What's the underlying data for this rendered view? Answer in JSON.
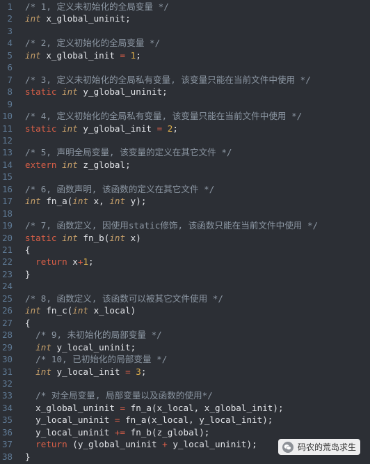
{
  "editor": {
    "line_numbers": [
      "1",
      "2",
      "3",
      "4",
      "5",
      "6",
      "7",
      "8",
      "9",
      "10",
      "11",
      "12",
      "13",
      "14",
      "15",
      "16",
      "17",
      "18",
      "19",
      "20",
      "21",
      "22",
      "23",
      "24",
      "25",
      "26",
      "27",
      "28",
      "29",
      "30",
      "31",
      "32",
      "33",
      "34",
      "35",
      "36",
      "37",
      "38"
    ],
    "lines": [
      [
        [
          "comment",
          "/* 1, 定义未初始化的全局变量 */"
        ]
      ],
      [
        [
          "type",
          "int"
        ],
        [
          "plain",
          " x_global_uninit;"
        ]
      ],
      [],
      [
        [
          "comment",
          "/* 2, 定义初始化的全局变量 */"
        ]
      ],
      [
        [
          "type",
          "int"
        ],
        [
          "plain",
          " x_global_init "
        ],
        [
          "op",
          "="
        ],
        [
          "plain",
          " "
        ],
        [
          "num",
          "1"
        ],
        [
          "plain",
          ";"
        ]
      ],
      [],
      [
        [
          "comment",
          "/* 3, 定义未初始化的全局私有变量, 该变量只能在当前文件中使用 */"
        ]
      ],
      [
        [
          "kw",
          "static"
        ],
        [
          "plain",
          " "
        ],
        [
          "type",
          "int"
        ],
        [
          "plain",
          " y_global_uninit;"
        ]
      ],
      [],
      [
        [
          "comment",
          "/* 4, 定义初始化的全局私有变量, 该变量只能在当前文件中使用 */"
        ]
      ],
      [
        [
          "kw",
          "static"
        ],
        [
          "plain",
          " "
        ],
        [
          "type",
          "int"
        ],
        [
          "plain",
          " y_global_init "
        ],
        [
          "op",
          "="
        ],
        [
          "plain",
          " "
        ],
        [
          "num",
          "2"
        ],
        [
          "plain",
          ";"
        ]
      ],
      [],
      [
        [
          "comment",
          "/* 5, 声明全局变量, 该变量的定义在其它文件 */"
        ]
      ],
      [
        [
          "kw",
          "extern"
        ],
        [
          "plain",
          " "
        ],
        [
          "type",
          "int"
        ],
        [
          "plain",
          " z_global;"
        ]
      ],
      [],
      [
        [
          "comment",
          "/* 6, 函数声明, 该函数的定义在其它文件 */"
        ]
      ],
      [
        [
          "type",
          "int"
        ],
        [
          "plain",
          " fn_a("
        ],
        [
          "type",
          "int"
        ],
        [
          "plain",
          " x, "
        ],
        [
          "type",
          "int"
        ],
        [
          "plain",
          " y);"
        ]
      ],
      [],
      [
        [
          "comment",
          "/* 7, 函数定义, 因使用static修饰, 该函数只能在当前文件中使用 */"
        ]
      ],
      [
        [
          "kw",
          "static"
        ],
        [
          "plain",
          " "
        ],
        [
          "type",
          "int"
        ],
        [
          "plain",
          " fn_b("
        ],
        [
          "type",
          "int"
        ],
        [
          "plain",
          " x)"
        ]
      ],
      [
        [
          "plain",
          "{"
        ]
      ],
      [
        [
          "plain",
          "  "
        ],
        [
          "kw",
          "return"
        ],
        [
          "plain",
          " x"
        ],
        [
          "op",
          "+"
        ],
        [
          "num",
          "1"
        ],
        [
          "plain",
          ";"
        ]
      ],
      [
        [
          "plain",
          "}"
        ]
      ],
      [],
      [
        [
          "comment",
          "/* 8, 函数定义, 该函数可以被其它文件使用 */"
        ]
      ],
      [
        [
          "type",
          "int"
        ],
        [
          "plain",
          " fn_c("
        ],
        [
          "type",
          "int"
        ],
        [
          "plain",
          " x_local)"
        ]
      ],
      [
        [
          "plain",
          "{"
        ]
      ],
      [
        [
          "plain",
          "  "
        ],
        [
          "comment",
          "/* 9, 未初始化的局部变量 */"
        ]
      ],
      [
        [
          "plain",
          "  "
        ],
        [
          "type",
          "int"
        ],
        [
          "plain",
          " y_local_uninit;"
        ]
      ],
      [
        [
          "plain",
          "  "
        ],
        [
          "comment",
          "/* 10, 已初始化的局部变量 */"
        ]
      ],
      [
        [
          "plain",
          "  "
        ],
        [
          "type",
          "int"
        ],
        [
          "plain",
          " y_local_init "
        ],
        [
          "op",
          "="
        ],
        [
          "plain",
          " "
        ],
        [
          "num",
          "3"
        ],
        [
          "plain",
          ";"
        ]
      ],
      [],
      [
        [
          "plain",
          "  "
        ],
        [
          "comment",
          "/* 对全局变量, 局部变量以及函数的使用*/"
        ]
      ],
      [
        [
          "plain",
          "  x_global_uninit "
        ],
        [
          "op",
          "="
        ],
        [
          "plain",
          " fn_a(x_local, x_global_init);"
        ]
      ],
      [
        [
          "plain",
          "  y_local_uninit "
        ],
        [
          "op",
          "="
        ],
        [
          "plain",
          " fn_a(x_local, y_local_init);"
        ]
      ],
      [
        [
          "plain",
          "  y_local_uninit "
        ],
        [
          "op",
          "+="
        ],
        [
          "plain",
          " fn_b(z_global);"
        ]
      ],
      [
        [
          "plain",
          "  "
        ],
        [
          "kw",
          "return"
        ],
        [
          "plain",
          " (y_global_uninit "
        ],
        [
          "op",
          "+"
        ],
        [
          "plain",
          " y_local_uninit);"
        ]
      ],
      [
        [
          "plain",
          "}"
        ]
      ]
    ]
  },
  "watermark": {
    "label": "码农的荒岛求生",
    "icon": "wechat-icon"
  }
}
